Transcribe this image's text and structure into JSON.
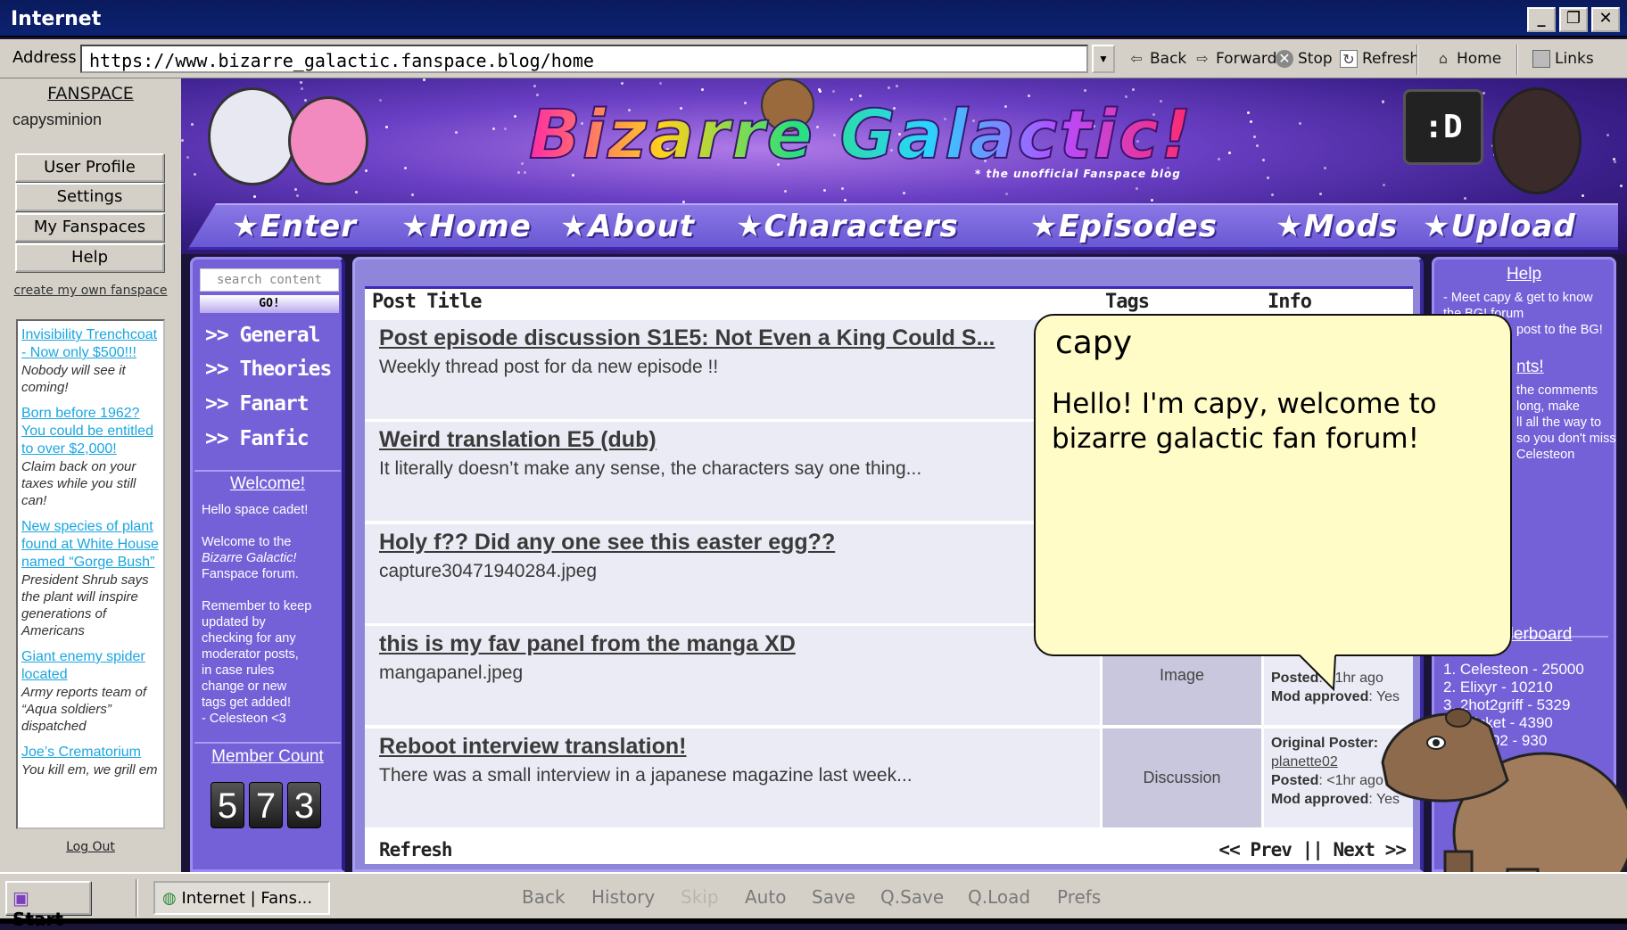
{
  "window": {
    "title": "Internet",
    "buttons": [
      "minimize",
      "maximize",
      "close"
    ]
  },
  "address_bar": {
    "label": "Address",
    "url": "https://www.bizarre_galactic.fanspace.blog/home"
  },
  "toolbar": {
    "back": "Back",
    "forward": "Forward",
    "stop": "Stop",
    "refresh": "Refresh",
    "home": "Home",
    "links": "Links"
  },
  "sidebar": {
    "brand": "FANSPACE",
    "username": "capysminion",
    "buttons": [
      "User Profile",
      "Settings",
      "My Fanspaces",
      "Help"
    ],
    "create_link": "create my own fanspace",
    "ads": [
      {
        "title": "Invisibility Trenchcoat - Now only $500!!!",
        "desc": "Nobody will see it coming!"
      },
      {
        "title": "Born before 1962? You could be entitled to over $2,000!",
        "desc": "Claim back on your taxes while you still can!"
      },
      {
        "title": "New species of plant found at White House named “Gorge Bush”",
        "desc": "President Shrub says the plant will inspire generations of Americans"
      },
      {
        "title": "Giant enemy spider located",
        "desc": "Army reports team of “Aqua soldiers” dispatched"
      },
      {
        "title": "Joe’s Crematorium",
        "desc": "You kill em, we grill em"
      }
    ],
    "logout": "Log Out"
  },
  "banner": {
    "title": "Bizarre Galactic!",
    "subtitle": "* the unofficial Fanspace blog",
    "nav": [
      "★Enter",
      "★Home",
      "★About",
      "★Characters",
      "★Episodes",
      "★Mods",
      "★Upload"
    ]
  },
  "left_nav": {
    "search_placeholder": "search content",
    "go": "GO!",
    "categories": [
      ">> General",
      ">> Theories",
      ">> Fanart",
      ">> Fanfic"
    ],
    "welcome_heading": "Welcome!",
    "welcome_text": "Hello space cadet!\n\nWelcome to the\nBizarre Galactic!\nFanspace forum.\n\nRemember to keep\nupdated by\nchecking for any\nmoderator posts,\nin case rules\nchange or new\ntags get added!\n- Celesteon <3",
    "member_count_heading": "Member Count",
    "member_count": [
      "5",
      "7",
      "3"
    ]
  },
  "posts": {
    "headers": {
      "title": "Post Title",
      "tags": "Tags",
      "info": "Info"
    },
    "rows": [
      {
        "title": "Post episode discussion S1E5: Not Even a King Could S...",
        "excerpt": "Weekly thread post for da new episode !!"
      },
      {
        "title": "Weird translation E5 (dub)",
        "excerpt": "It literally doesn’t make any sense, the characters say one thing..."
      },
      {
        "title": "Holy f?? Did any one see this easter egg??",
        "excerpt": "capture30471940284.jpeg"
      },
      {
        "title": "this is my fav panel from the manga XD",
        "excerpt": "mangapanel.jpeg",
        "tag": "Image",
        "posted_label": "Posted",
        "posted": ": <1hr ago",
        "mod_label": "Mod approved",
        "mod": ": Yes"
      },
      {
        "title": "Reboot interview translation!",
        "excerpt": "There was a small interview in a japanese magazine last week...",
        "tag": "Discussion",
        "op_label": "Original Poster:",
        "op": "planette02",
        "posted_label": "Posted",
        "posted": ": <1hr ago",
        "mod_label": "Mod approved",
        "mod": ": Yes"
      }
    ],
    "refresh": "Refresh",
    "pager": "<< Prev || Next >>"
  },
  "right_panel": {
    "help_heading": "Help",
    "help_lines": [
      "- Meet capy & get to know",
      "the BG! forum",
      "post to the BG!"
    ],
    "second_heading_fragment": "nts!",
    "second_lines": [
      "the comments",
      "long, make",
      "ll all the way to",
      "so you don't miss",
      "Celesteon"
    ],
    "leaderboard_heading": "Leaderboard",
    "leaderboard": [
      "1. Celesteon - 25000",
      "2. Elixyr - 10210",
      "3. 2hot2griff - 5329",
      "icket - 4390",
      "tte02 - 930"
    ]
  },
  "bubble": {
    "speaker": "capy",
    "message": "Hello! I'm capy, welcome to bizarre galactic fan forum!"
  },
  "taskbar": {
    "start": "Start",
    "task": "Internet | Fans...",
    "menu": [
      {
        "label": "Back",
        "enabled": true
      },
      {
        "label": "History",
        "enabled": true
      },
      {
        "label": "Skip",
        "enabled": false
      },
      {
        "label": "Auto",
        "enabled": true
      },
      {
        "label": "Save",
        "enabled": true
      },
      {
        "label": "Q.Save",
        "enabled": true
      },
      {
        "label": "Q.Load",
        "enabled": true
      },
      {
        "label": "Prefs",
        "enabled": true
      }
    ]
  },
  "colors": {
    "panel": "#7461d8",
    "main_panel": "#8f86dc",
    "bubble": "#fffcc8",
    "title_bar": "#0c2272",
    "chrome": "#d4d0c8"
  }
}
